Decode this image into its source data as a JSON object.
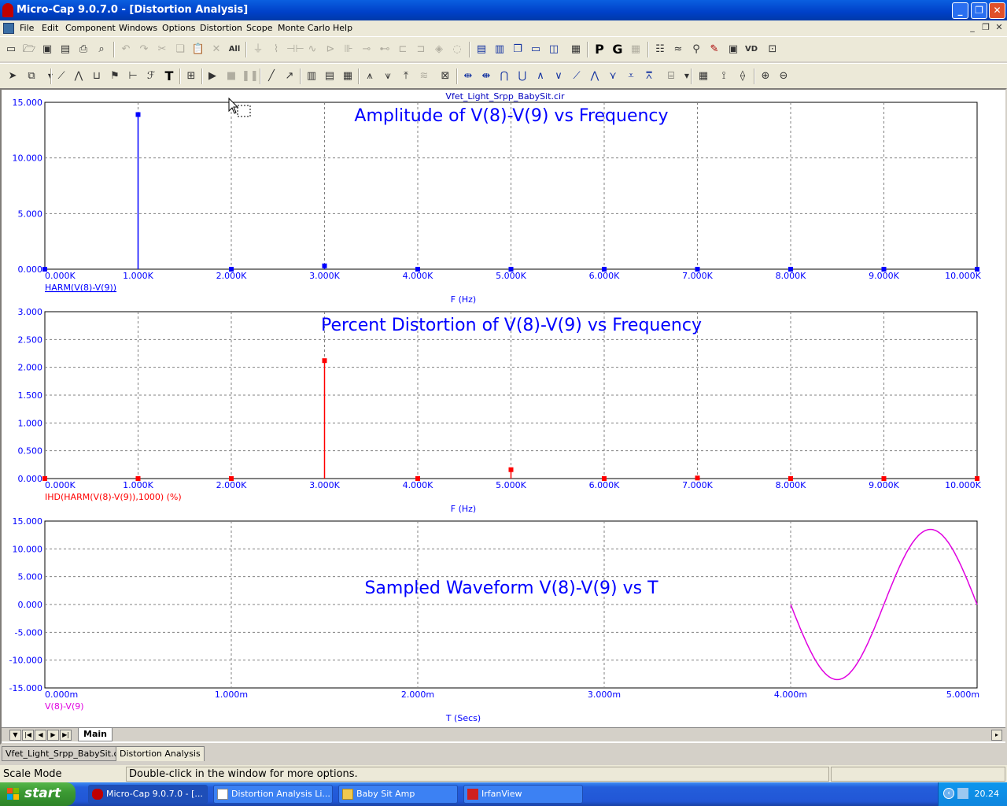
{
  "window": {
    "title": "Micro-Cap 9.0.7.0 - [Distortion Analysis]"
  },
  "menu": [
    "File",
    "Edit",
    "Component",
    "Windows",
    "Options",
    "Distortion",
    "Scope",
    "Monte Carlo",
    "Help"
  ],
  "toolbar1_icons": [
    "new-icon",
    "open-icon",
    "save-icon",
    "save-all-icon",
    "print-icon",
    "print-preview-icon",
    "undo-icon",
    "redo-icon",
    "cut-icon",
    "copy-icon",
    "paste-icon",
    "delete-icon",
    "select-all-icon",
    "ground-icon",
    "resistor-icon",
    "capacitor-icon",
    "inductor-icon",
    "diode-icon",
    "battery-icon",
    "npn-icon",
    "pnp-icon",
    "nmos-icon",
    "pmos-icon",
    "opamp-icon",
    "source-icon",
    "tile-horizontal-icon",
    "tile-vertical-icon",
    "cascade-icon",
    "window-icon",
    "split-icon",
    "calculator-icon",
    "p-icon",
    "g-icon",
    "grid-icon"
  ],
  "toolbar2_icons": [
    "select-arrow-icon",
    "component-icon",
    "wire-icon",
    "text-icon",
    "run-icon",
    "stop-icon",
    "pause-icon",
    "zoom-in-icon",
    "zoom-out-icon"
  ],
  "document": {
    "circuit_file": "Vfet_Light_Srpp_BabySit.cir",
    "sheet_tab": "Main"
  },
  "doc_tabs": [
    "Vfet_Light_Srpp_BabySit.cir",
    "Distortion Analysis"
  ],
  "status": {
    "mode": "Scale Mode",
    "message": "Double-click in the window for more options."
  },
  "taskbar": {
    "start": "start",
    "tasks": [
      "Micro-Cap 9.0.7.0 - [...",
      "Distortion Analysis Li...",
      "Baby Sit Amp",
      "IrfanView"
    ],
    "clock": "20.24"
  },
  "chart_data": [
    {
      "type": "bar",
      "title": "Amplitude of V(8)-V(9) vs Frequency",
      "xlabel": "F (Hz)",
      "series": [
        {
          "name": "HARM(V(8)-V(9))",
          "color": "#0000ff",
          "x": [
            0,
            1000,
            2000,
            3000,
            4000,
            5000,
            6000,
            7000,
            8000,
            9000,
            10000
          ],
          "values": [
            0,
            13.9,
            0,
            0.3,
            0,
            0,
            0,
            0,
            0,
            0,
            0
          ]
        }
      ],
      "xlim": [
        0,
        10000
      ],
      "ylim": [
        0,
        15
      ],
      "xticks": [
        "0.000K",
        "1.000K",
        "2.000K",
        "3.000K",
        "4.000K",
        "5.000K",
        "6.000K",
        "7.000K",
        "8.000K",
        "9.000K",
        "10.000K"
      ],
      "yticks": [
        "0.000",
        "5.000",
        "10.000",
        "15.000"
      ],
      "grid": true
    },
    {
      "type": "bar",
      "title": "Percent Distortion of V(8)-V(9) vs Frequency",
      "xlabel": "F (Hz)",
      "series": [
        {
          "name": "IHD(HARM(V(8)-V(9)),1000) (%)",
          "color": "#ff0000",
          "x": [
            0,
            1000,
            2000,
            3000,
            4000,
            5000,
            6000,
            7000,
            8000,
            9000,
            10000
          ],
          "values": [
            0,
            0,
            0,
            2.12,
            0,
            0.16,
            0,
            0.01,
            0,
            0,
            0
          ]
        }
      ],
      "xlim": [
        0,
        10000
      ],
      "ylim": [
        0,
        3
      ],
      "xticks": [
        "0.000K",
        "1.000K",
        "2.000K",
        "3.000K",
        "4.000K",
        "5.000K",
        "6.000K",
        "7.000K",
        "8.000K",
        "9.000K",
        "10.000K"
      ],
      "yticks": [
        "0.000",
        "0.500",
        "1.000",
        "1.500",
        "2.000",
        "2.500",
        "3.000"
      ],
      "grid": true
    },
    {
      "type": "line",
      "title": "Sampled Waveform  V(8)-V(9) vs T",
      "xlabel": "T (Secs)",
      "series": [
        {
          "name": "V(8)-V(9)",
          "color": "#e000e0",
          "amplitude": 13.5,
          "t_start": 0.004,
          "t_end": 0.005,
          "frequency": 1000,
          "phase": "starts at 0.000 going negative"
        }
      ],
      "xlim": [
        0,
        0.005
      ],
      "ylim": [
        -15,
        15
      ],
      "xticks": [
        "0.000m",
        "1.000m",
        "2.000m",
        "3.000m",
        "4.000m",
        "5.000m"
      ],
      "yticks": [
        "-15.000",
        "-10.000",
        "-5.000",
        "0.000",
        "5.000",
        "10.000",
        "15.000"
      ],
      "grid": true
    }
  ]
}
